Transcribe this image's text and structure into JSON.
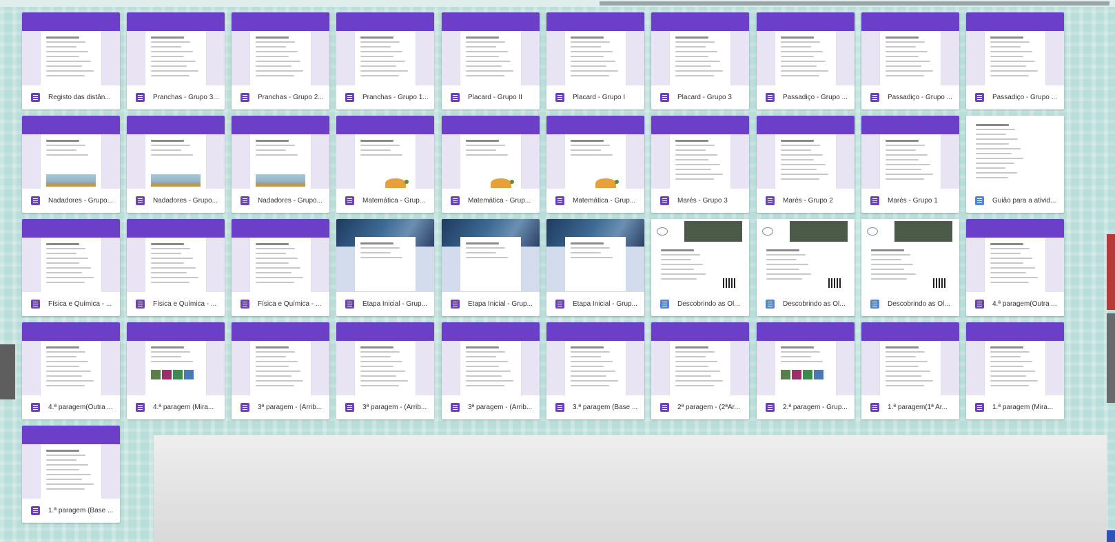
{
  "colors": {
    "forms_accent": "#6b3fc7",
    "docs_accent": "#4a86e8"
  },
  "files": [
    {
      "title": "Registo das distân...",
      "type": "form",
      "thumb": "form"
    },
    {
      "title": "Pranchas - Grupo 3...",
      "type": "form",
      "thumb": "form"
    },
    {
      "title": "Pranchas - Grupo 2...",
      "type": "form",
      "thumb": "form"
    },
    {
      "title": "Pranchas - Grupo 1...",
      "type": "form",
      "thumb": "form"
    },
    {
      "title": "Placard - Grupo II",
      "type": "form",
      "thumb": "form"
    },
    {
      "title": "Placard - Grupo I",
      "type": "form",
      "thumb": "form"
    },
    {
      "title": "Placard - Grupo 3",
      "type": "form",
      "thumb": "form"
    },
    {
      "title": "Passadiço - Grupo ...",
      "type": "form",
      "thumb": "form"
    },
    {
      "title": "Passadiço - Grupo ...",
      "type": "form",
      "thumb": "form"
    },
    {
      "title": "Passadiço - Grupo ...",
      "type": "form",
      "thumb": "form"
    },
    {
      "title": "Nadadores - Grupo...",
      "type": "form",
      "thumb": "scene"
    },
    {
      "title": "Nadadores - Grupo...",
      "type": "form",
      "thumb": "scene"
    },
    {
      "title": "Nadadores - Grupo...",
      "type": "form",
      "thumb": "scene"
    },
    {
      "title": "Matemática - Grup...",
      "type": "form",
      "thumb": "fruit"
    },
    {
      "title": "Matemática - Grup...",
      "type": "form",
      "thumb": "fruit"
    },
    {
      "title": "Matemática - Grup...",
      "type": "form",
      "thumb": "fruit"
    },
    {
      "title": "Marés - Grupo 3",
      "type": "form",
      "thumb": "form"
    },
    {
      "title": "Marés - Grupo 2",
      "type": "form",
      "thumb": "form"
    },
    {
      "title": "Marés - Grupo 1",
      "type": "form",
      "thumb": "form"
    },
    {
      "title": "Guião para a ativid...",
      "type": "doc",
      "thumb": "guide"
    },
    {
      "title": "Física e Química - ...",
      "type": "form",
      "thumb": "form"
    },
    {
      "title": "Física e Química - ...",
      "type": "form",
      "thumb": "form"
    },
    {
      "title": "Física e Química - ...",
      "type": "form",
      "thumb": "form"
    },
    {
      "title": "Etapa Inicial - Grup...",
      "type": "form",
      "thumb": "space"
    },
    {
      "title": "Etapa Inicial - Grup...",
      "type": "form",
      "thumb": "space"
    },
    {
      "title": "Etapa Inicial - Grup...",
      "type": "form",
      "thumb": "space"
    },
    {
      "title": "Descobrindo as Ol...",
      "type": "doc",
      "thumb": "doc"
    },
    {
      "title": "Descobrindo as Ol...",
      "type": "doc",
      "thumb": "doc"
    },
    {
      "title": "Descobrindo as Ol...",
      "type": "doc",
      "thumb": "doc"
    },
    {
      "title": "4.ª paragem(Outra ...",
      "type": "form",
      "thumb": "form"
    },
    {
      "title": "4.ª paragem(Outra ...",
      "type": "form",
      "thumb": "form"
    },
    {
      "title": "4.ª paragem (Mira...",
      "type": "form",
      "thumb": "pics"
    },
    {
      "title": "3ª paragem - (Arrib...",
      "type": "form",
      "thumb": "form"
    },
    {
      "title": "3ª paragem - (Arrib...",
      "type": "form",
      "thumb": "form"
    },
    {
      "title": "3ª paragem - (Arrib...",
      "type": "form",
      "thumb": "form"
    },
    {
      "title": "3.ª paragem (Base ...",
      "type": "form",
      "thumb": "form"
    },
    {
      "title": "2ª paragem - (2ªAr...",
      "type": "form",
      "thumb": "form"
    },
    {
      "title": "2.ª paragem - Grup...",
      "type": "form",
      "thumb": "pics"
    },
    {
      "title": "1.ª paragem(1ª Ar...",
      "type": "form",
      "thumb": "form"
    },
    {
      "title": "1.ª paragem (Mira...",
      "type": "form",
      "thumb": "form"
    },
    {
      "title": "1.ª paragem (Base ...",
      "type": "form",
      "thumb": "form"
    }
  ]
}
